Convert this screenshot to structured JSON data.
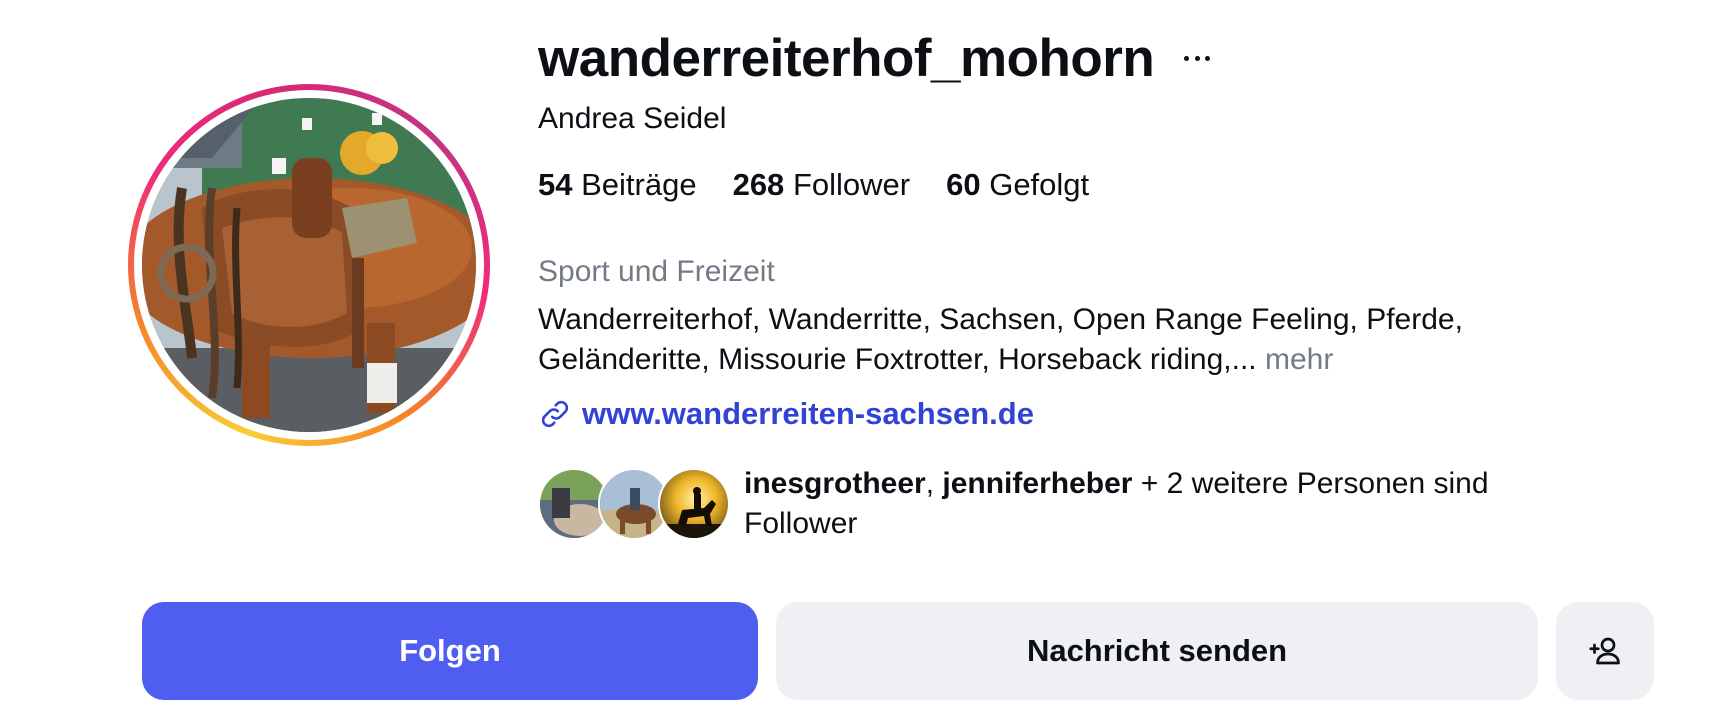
{
  "profile": {
    "username": "wanderreiterhof_mohorn",
    "full_name": "Andrea Seidel",
    "category": "Sport und Freizeit",
    "bio_line_1": "Wanderreiterhof, Wanderritte, Sachsen, Open Range Feeling, Pferde,",
    "bio_line_2": "Geländeritte, Missourie Foxtrotter, Horseback riding,...",
    "bio_more": "mehr",
    "website": "www.wanderreiten-sachsen.de"
  },
  "stats": {
    "posts_count": "54",
    "posts_label": "Beiträge",
    "followers_count": "268",
    "followers_label": "Follower",
    "following_count": "60",
    "following_label": "Gefolgt"
  },
  "mutual_followers": {
    "user_1": "inesgrotheer",
    "separator": ", ",
    "user_2": "jenniferheber",
    "suffix_line_1": " + 2 weitere Personen sind",
    "suffix_line_2": "Follower"
  },
  "actions": {
    "follow_label": "Folgen",
    "message_label": "Nachricht senden"
  },
  "colors": {
    "accent": "#4f5ef0",
    "link": "#3143d6",
    "secondary_text": "#737b86",
    "button_gray": "#eff0f4"
  },
  "icons": {
    "more": "more-options-icon",
    "link": "link-icon",
    "suggest": "add-person-icon"
  }
}
